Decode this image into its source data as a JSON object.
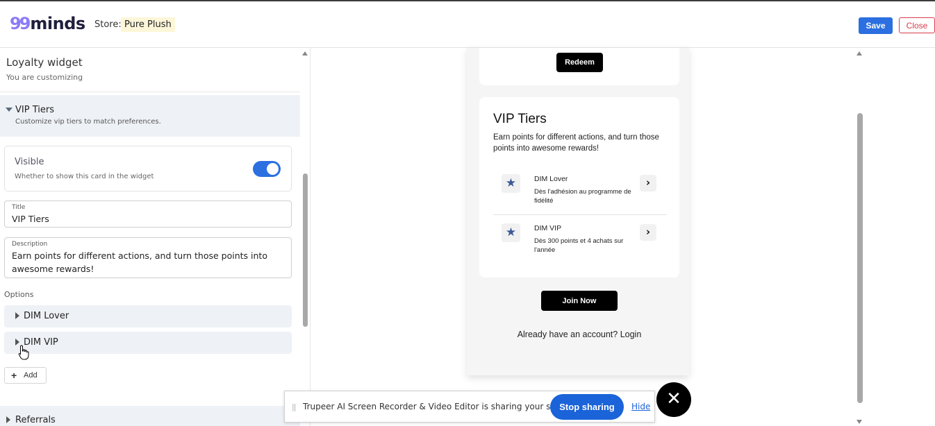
{
  "header": {
    "logo_mark": "99",
    "logo_text": "minds",
    "store_label": "Store:",
    "store_name": "Pure Plush",
    "save_label": "Save",
    "close_label": "Close"
  },
  "sidebar": {
    "title": "Loyalty widget",
    "subtitle": "You are customizing",
    "section": {
      "title": "VIP Tiers",
      "subtitle": "Customize vip tiers to match preferences."
    },
    "visible": {
      "title": "Visible",
      "subtitle": "Whether to show this card in the widget",
      "enabled": true
    },
    "title_field": {
      "label": "Title",
      "value": "VIP Tiers"
    },
    "description_field": {
      "label": "Description",
      "line1": "Earn points for different actions, and turn those points into",
      "line2": "awesome rewards!"
    },
    "options_label": "Options",
    "options": [
      {
        "label": "DIM Lover"
      },
      {
        "label": "DIM VIP"
      }
    ],
    "add_label": "Add",
    "referrals_label": "Referrals"
  },
  "preview": {
    "redeem_label": "Redeem",
    "vip_title": "VIP Tiers",
    "vip_desc": "Earn points for different actions, and turn those points into awesome rewards!",
    "tiers": [
      {
        "name": "DIM Lover",
        "desc": "Dès l'adhésion au programme de fidélité",
        "icon": "star-icon"
      },
      {
        "name": "DIM VIP",
        "desc": "Dès 300 points et 4 achats sur l'année",
        "icon": "star-icon"
      }
    ],
    "join_label": "Join Now",
    "login_text": "Already have an account?  Login"
  },
  "share_bar": {
    "message": "Trupeer AI Screen Recorder & Video Editor is sharing your screen.",
    "stop_label": "Stop sharing",
    "hide_label": "Hide",
    "close_glyph": "✕"
  },
  "colors": {
    "accent": "#2b6fe0",
    "danger": "#d93b4c",
    "stop_button": "#1a63d8",
    "star": "#3d5a99"
  }
}
